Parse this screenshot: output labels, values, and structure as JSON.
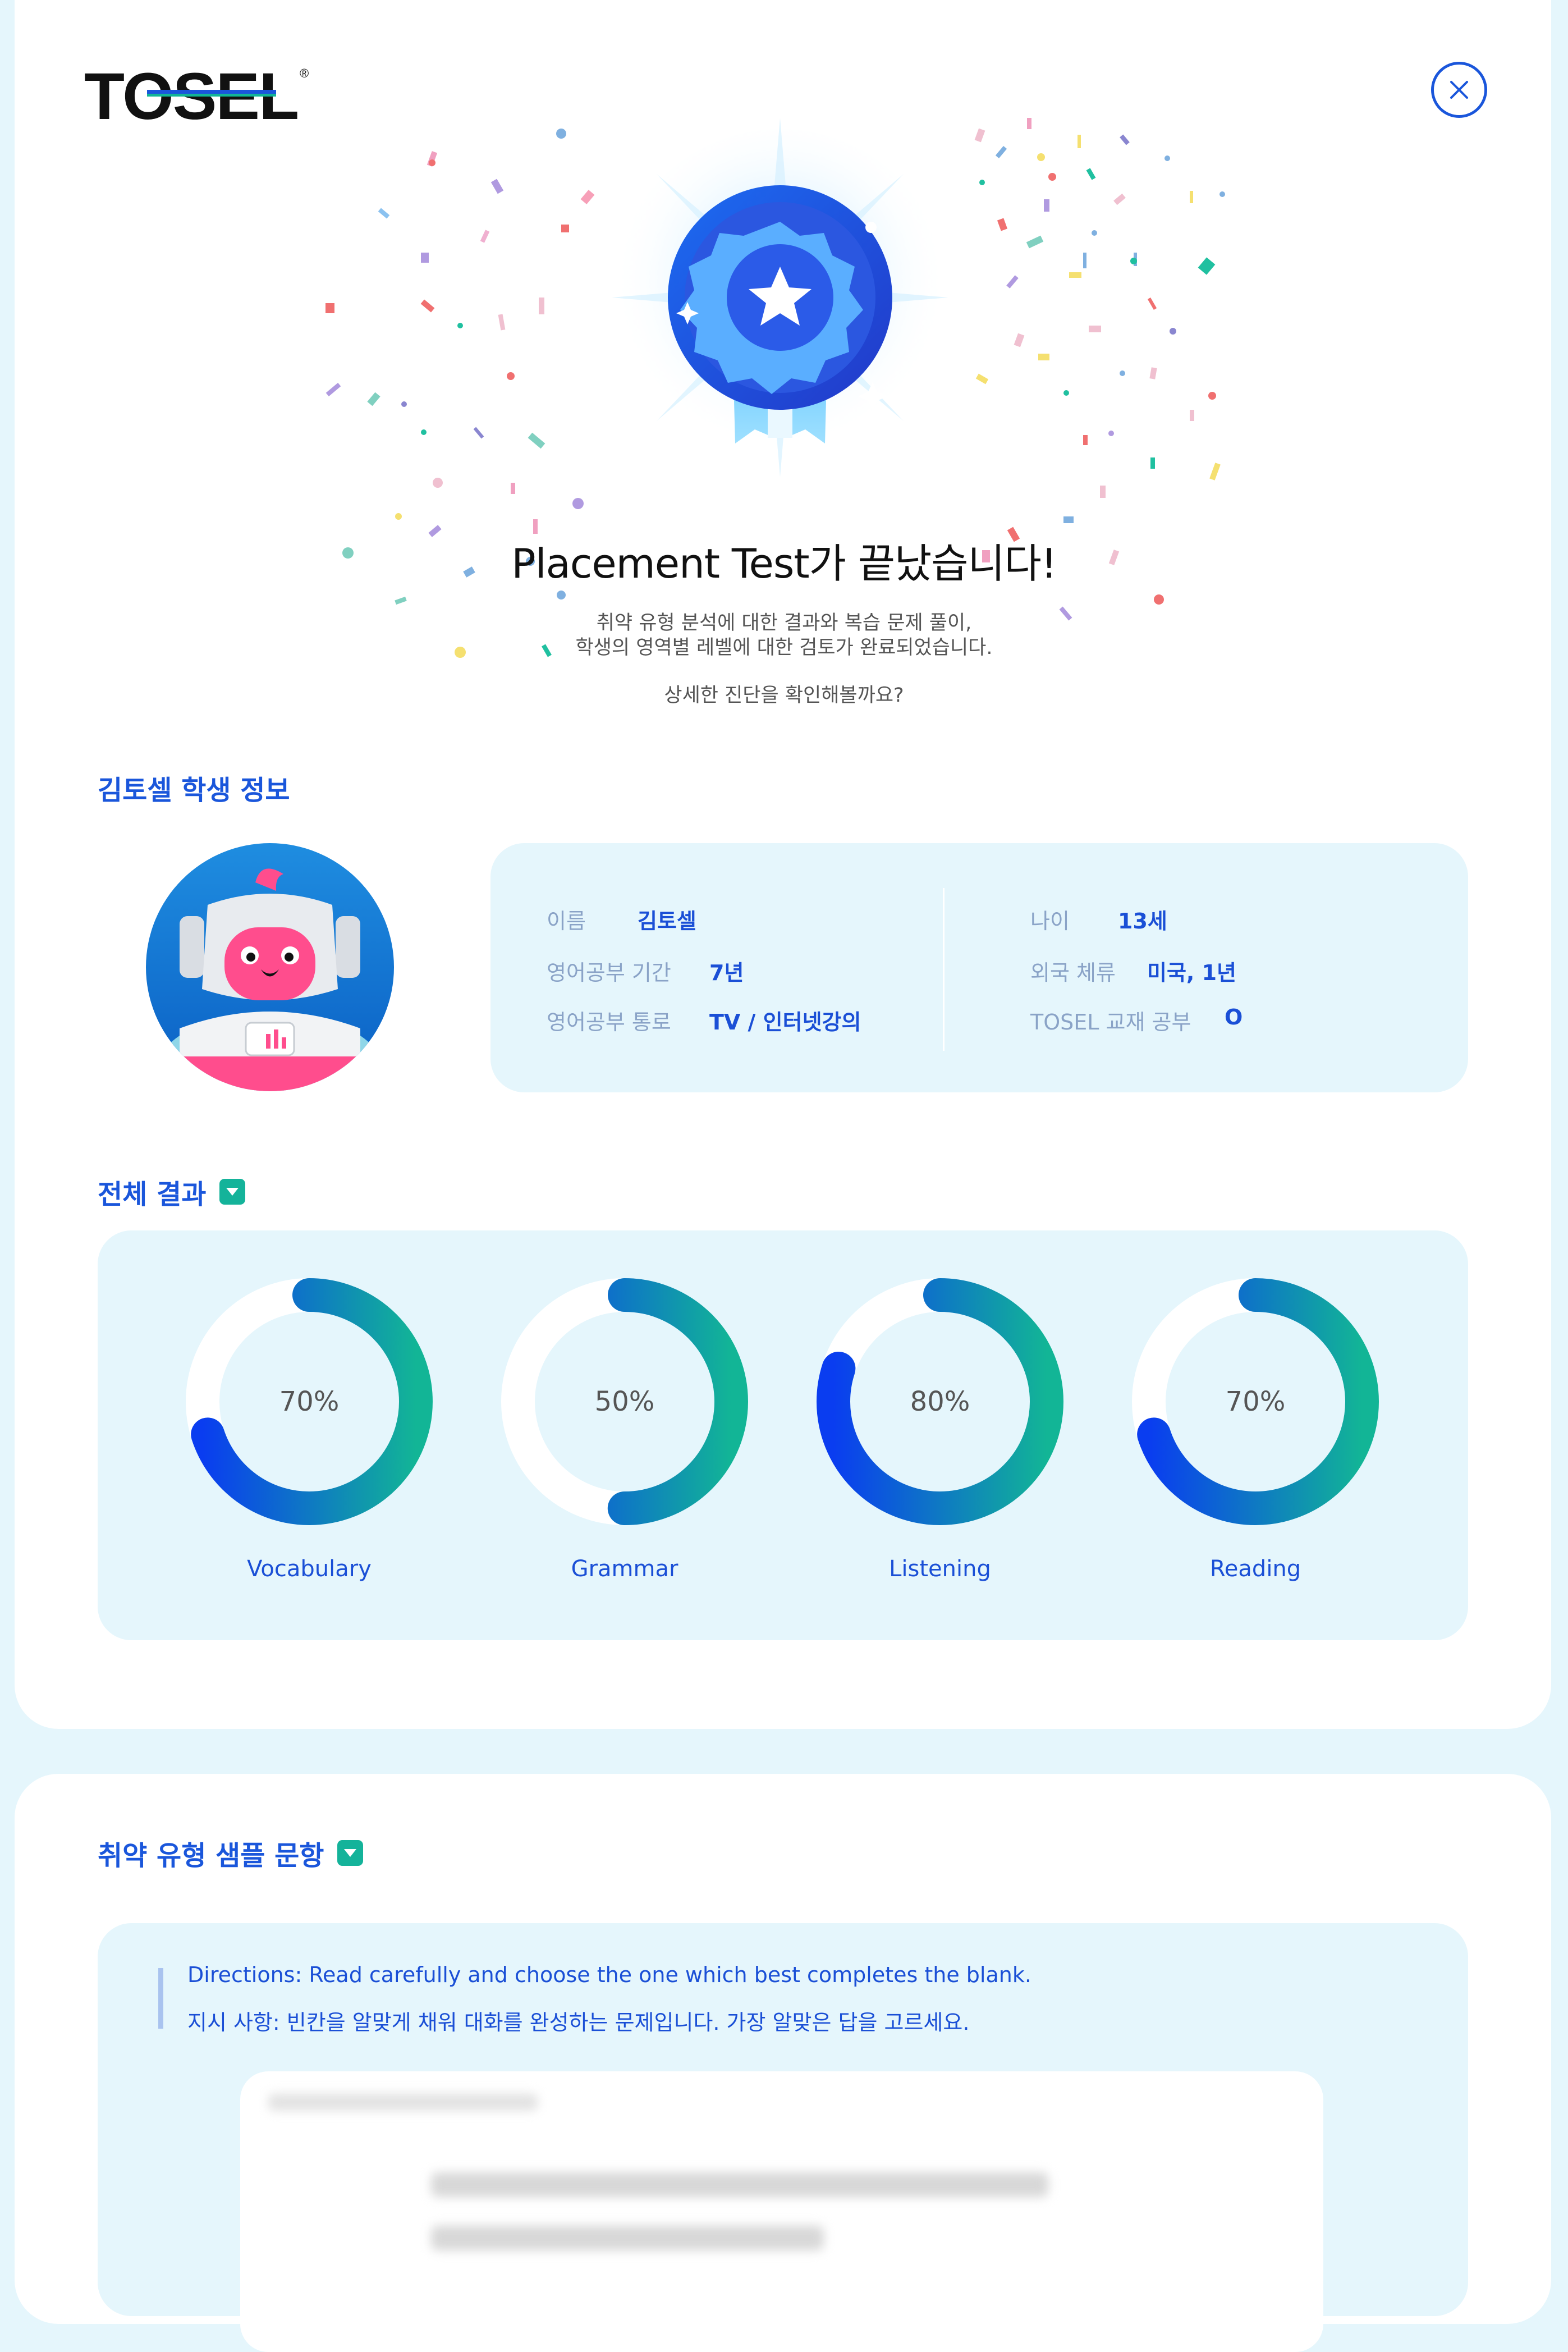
{
  "brand": {
    "logo_text": "TOSEL",
    "registered_mark": "®"
  },
  "hero": {
    "title": "Placement Test가 끝났습니다!",
    "description_lines": [
      "취약 유형 분석에 대한 결과와 복습 문제 풀이,",
      "학생의 영역별 레벨에 대한 검토가 완료되었습니다."
    ],
    "prompt": "상세한 진단을 확인해볼까요?"
  },
  "student_section": {
    "title": "김토셀 학생 정보",
    "info": {
      "name_label": "이름",
      "name_value": "김토셀",
      "period_label": "영어공부 기간",
      "period_value": "7년",
      "channel_label": "영어공부 통로",
      "channel_value": "TV / 인터넷강의",
      "age_label": "나이",
      "age_value": "13세",
      "abroad_label": "외국 체류",
      "abroad_value": "미국, 1년",
      "tosel_label": "TOSEL 교재 공부",
      "tosel_value": "O"
    }
  },
  "results_section": {
    "title": "전체 결과",
    "items": [
      {
        "label": "Vocabulary",
        "percent": 70,
        "percent_text": "70%"
      },
      {
        "label": "Grammar",
        "percent": 50,
        "percent_text": "50%"
      },
      {
        "label": "Listening",
        "percent": 80,
        "percent_text": "80%"
      },
      {
        "label": "Reading",
        "percent": 70,
        "percent_text": "70%"
      }
    ]
  },
  "sample_section": {
    "title": "취약 유형 샘플 문항",
    "directions_en": "Directions: Read carefully and choose the one which best completes the blank.",
    "directions_ko": "지시 사항: 빈칸을 알맞게 채워 대화를 완성하는 문제입니다. 가장 알맞은 답을 고르세요."
  },
  "colors": {
    "brand_blue": "#1a56db",
    "ring_gradient_start": "#0a3df0",
    "ring_gradient_end": "#12b596",
    "panel_bg": "#e5f6fc",
    "toggle_chip": "#14b39a"
  },
  "icons": {
    "close": "close-icon",
    "medal": "medal-icon",
    "toggle": "caret-down-icon"
  }
}
